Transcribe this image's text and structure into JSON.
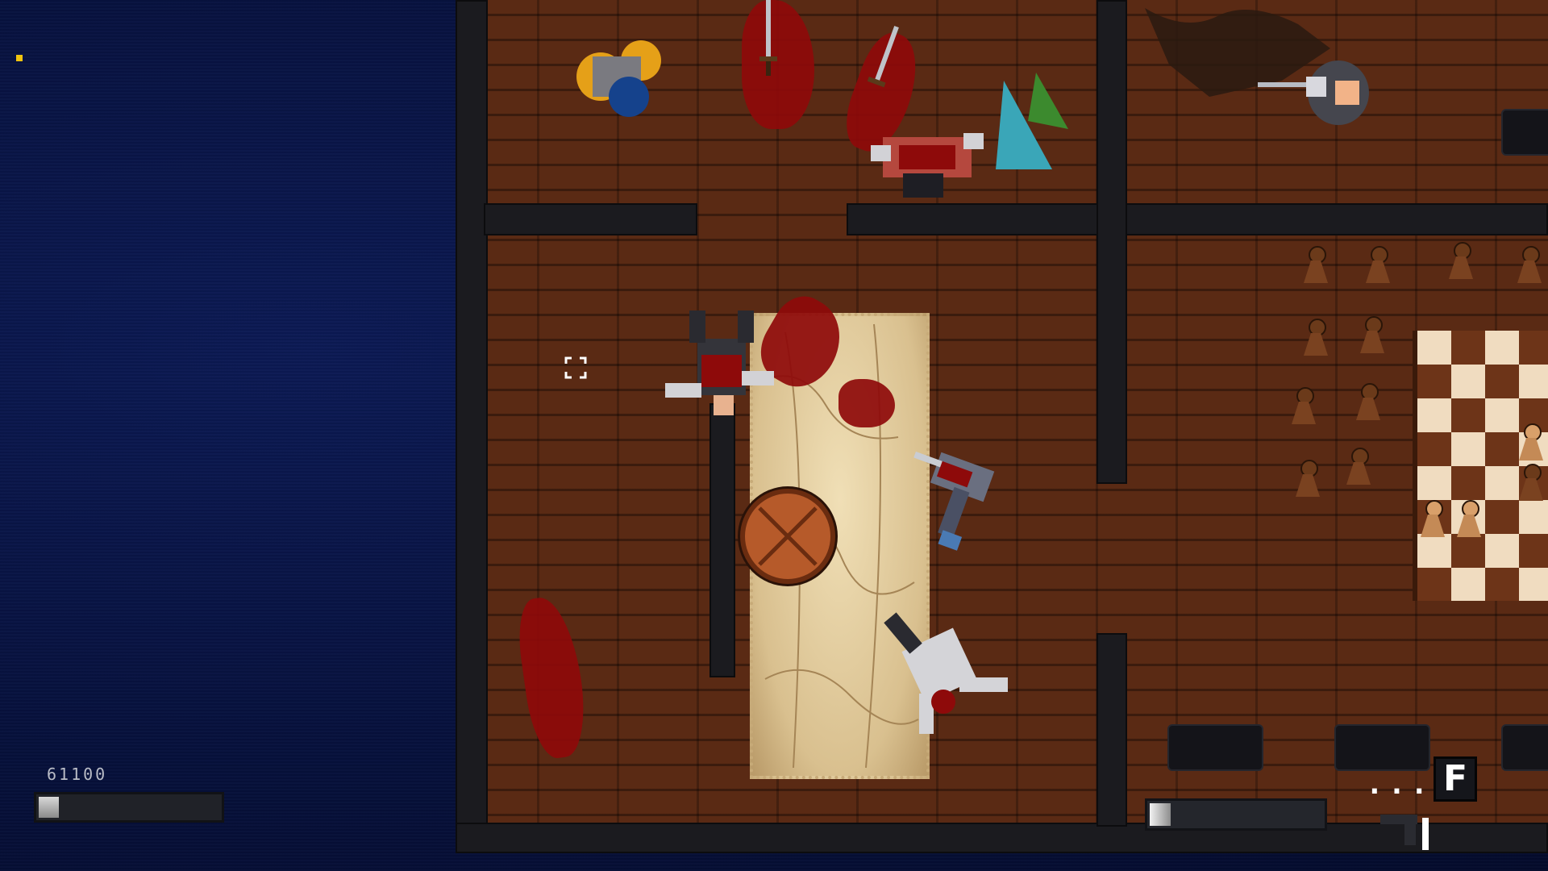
{
  "hud": {
    "score": "61100",
    "health_level": 0.11,
    "ammo_level": 0.12,
    "ammo_ellipsis": "...",
    "interact_key": "F"
  },
  "colors": {
    "void_bg": "#07103a",
    "floor": "#5a2a14",
    "wall": "#1b1b1f",
    "blood": "#8e0a0a",
    "minimap_marker": "#f1c40f"
  },
  "icons": {
    "crosshair": "crosshair-icon",
    "minimap_marker": "player-marker-icon",
    "weapon": "pistol-icon"
  }
}
